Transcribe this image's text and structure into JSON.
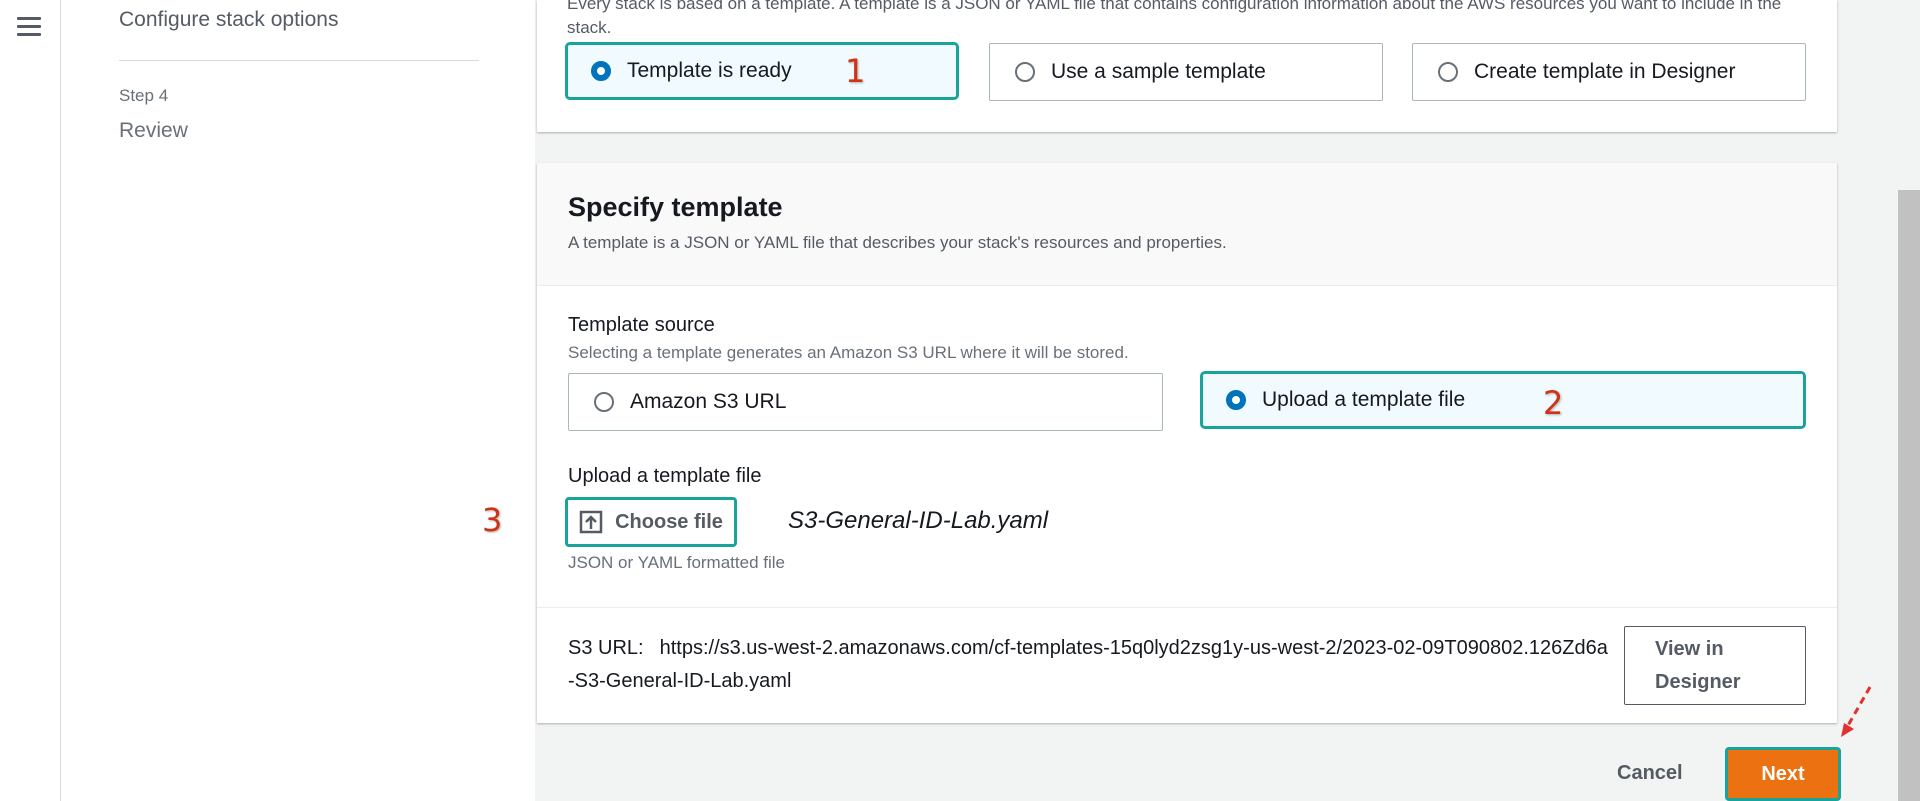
{
  "nav": {
    "step_current_label": "Configure stack options",
    "step4_num": "Step 4",
    "step4_label": "Review"
  },
  "prepare_template": {
    "description": "Every stack is based on a template. A template is a JSON or YAML file that contains configuration information about the AWS resources you want to include in the stack.",
    "options": [
      {
        "label": "Template is ready",
        "selected": true
      },
      {
        "label": "Use a sample template",
        "selected": false
      },
      {
        "label": "Create template in Designer",
        "selected": false
      }
    ]
  },
  "specify_template": {
    "title": "Specify template",
    "description": "A template is a JSON or YAML file that describes your stack's resources and properties.",
    "source_label": "Template source",
    "source_hint": "Selecting a template generates an Amazon S3 URL where it will be stored.",
    "source_options": [
      {
        "label": "Amazon S3 URL",
        "selected": false
      },
      {
        "label": "Upload a template file",
        "selected": true
      }
    ],
    "upload_label": "Upload a template file",
    "choose_file_label": "Choose file",
    "file_name": "S3-General-ID-Lab.yaml",
    "upload_hint": "JSON or YAML formatted file",
    "s3_url_key": "S3 URL:",
    "s3_url_value": "https://s3.us-west-2.amazonaws.com/cf-templates-15q0lyd2zsg1y-us-west-2/2023-02-09T090802.126Zd6a-S3-General-ID-Lab.yaml",
    "view_designer_line1": "View in",
    "view_designer_line2": "Designer"
  },
  "footer": {
    "cancel_label": "Cancel",
    "next_label": "Next"
  },
  "annotations": {
    "marker1": "1",
    "marker2": "2",
    "marker3": "3"
  },
  "colors": {
    "accent_teal": "#1aa39a",
    "radio_blue": "#0073bb",
    "primary_orange": "#ec7211",
    "annotation_red": "#d13212"
  }
}
